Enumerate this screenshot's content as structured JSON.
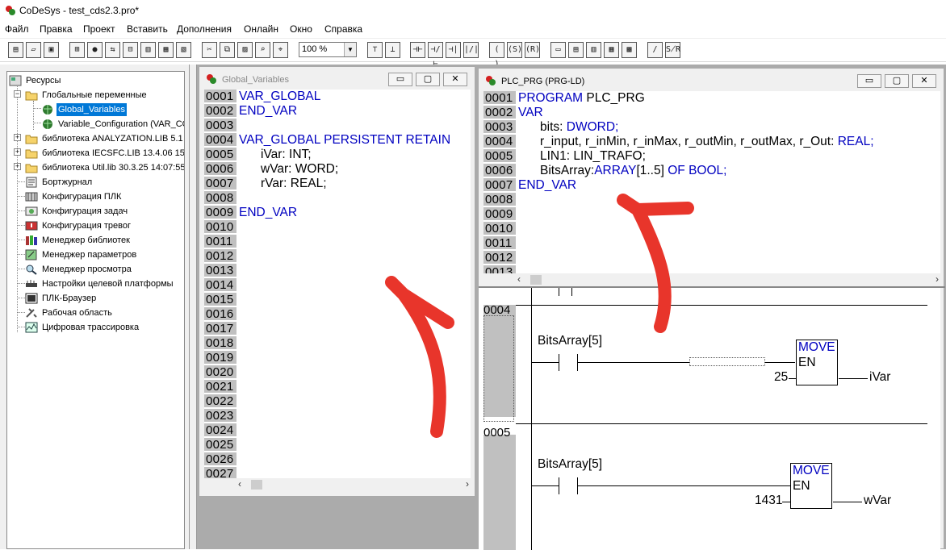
{
  "app": {
    "title": "CoDeSys - test_cds2.3.pro*"
  },
  "menu": [
    "Файл",
    "Правка",
    "Проект",
    "Вставить",
    "Дополнения",
    "Онлайн",
    "Окно",
    "Справка"
  ],
  "toolbar": {
    "zoom": "100 %"
  },
  "tree": {
    "root": "Ресурсы",
    "items": [
      "Глобальные переменные",
      "Global_Variables",
      "Variable_Configuration (VAR_CO",
      "библиотека ANALYZATION.LIB 5.1",
      "библиотека IECSFC.LIB 13.4.06 15",
      "библиотека Util.lib 30.3.25 14:07:55",
      "Бортжурнал",
      "Конфигурация ПЛК",
      "Конфигурация задач",
      "Конфигурация тревог",
      "Менеджер библиотек",
      "Менеджер параметров",
      "Менеджер просмотра",
      "Настройки целевой платформы",
      "ПЛК-Браузер",
      "Рабочая область",
      "Цифровая трассировка"
    ]
  },
  "global_window": {
    "title": "Global_Variables",
    "line_numbers": [
      "0001",
      "0002",
      "0003",
      "0004",
      "0005",
      "0006",
      "0007",
      "0008",
      "0009",
      "0010",
      "0011",
      "0012",
      "0013",
      "0014",
      "0015",
      "0016",
      "0017",
      "0018",
      "0019",
      "0020",
      "0021",
      "0022",
      "0023",
      "0024",
      "0025",
      "0026",
      "0027"
    ],
    "lines": [
      "VAR_GLOBAL",
      "END_VAR",
      "",
      "VAR_GLOBAL PERSISTENT RETAIN",
      "iVar: INT;",
      "wVar: WORD;",
      "rVar: REAL;",
      "",
      "END_VAR"
    ]
  },
  "plc_window": {
    "title": "PLC_PRG (PRG-LD)",
    "line_numbers": [
      "0001",
      "0002",
      "0003",
      "0004",
      "0005",
      "0006",
      "0007",
      "0008",
      "0009",
      "0010",
      "0011",
      "0012",
      "0013"
    ],
    "lines": {
      "l1_kw": "PROGRAM",
      "l1_name": "PLC_PRG",
      "l2": "VAR",
      "l3_name": "bits:",
      "l3_type": "DWORD;",
      "l4_name": "r_input, r_inMin, r_inMax, r_outMin, r_outMax, r_Out:",
      "l4_type": "REAL;",
      "l5": "LIN1: LIN_TRAFO;",
      "l6_name": "BitsArray:",
      "l6_type": "ARRAY",
      "l6_mid": "[1..5]",
      "l6_end": "OF BOOL;",
      "l7": "END_VAR"
    },
    "networks": [
      {
        "number": "0004",
        "contact": "BitsArray[5]",
        "block": "MOVE",
        "en": "EN",
        "input": "25",
        "output": "iVar"
      },
      {
        "number": "0005",
        "contact": "BitsArray[5]",
        "block": "MOVE",
        "en": "EN",
        "input": "1431",
        "output": "wVar"
      }
    ]
  },
  "colors": {
    "keyword": "#0000c0",
    "arrow": "#e8352b",
    "gutter": "#c0c0c0",
    "selection": "#0078d7"
  }
}
